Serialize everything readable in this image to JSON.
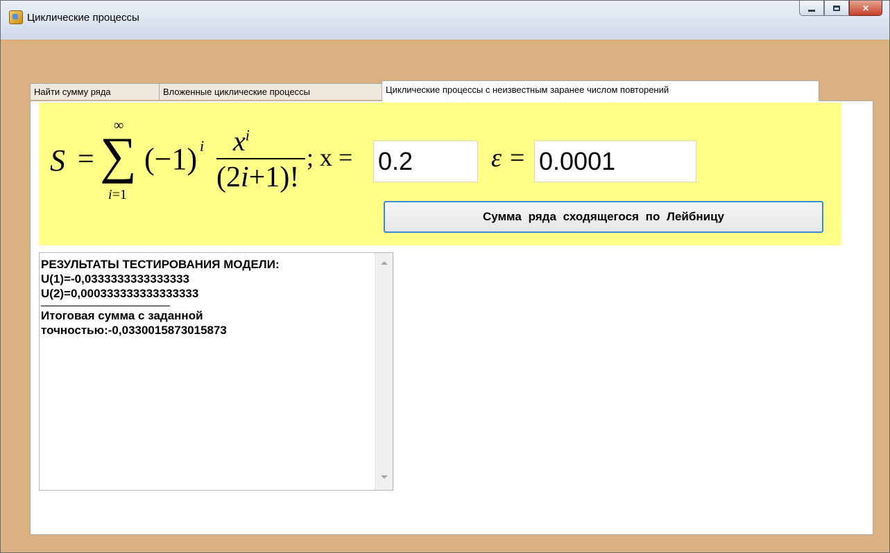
{
  "window": {
    "title": "Циклические процессы",
    "icons": {
      "app": "app-icon",
      "minimize": "minimize-icon",
      "maximize": "maximize-icon",
      "close": "close-icon"
    }
  },
  "tabs": [
    {
      "label": "Найти сумму ряда",
      "active": false
    },
    {
      "label": "Вложенные циклические процессы",
      "active": false
    },
    {
      "label": "Циклические процессы с неизвестным заранее числом повторений",
      "active": true
    }
  ],
  "formula": {
    "S": "S",
    "eq": "=",
    "sigma": "∑",
    "upper": "∞",
    "lower_i": "i",
    "lower_rest": "=1",
    "paren": "(−1)",
    "exp_i": "i",
    "num_x": "x",
    "num_exp": "i",
    "den_a": "(2",
    "den_i": "i",
    "den_b": "+1)!",
    "semi": "; x =",
    "eps": "ε ="
  },
  "inputs": {
    "x_value": "0.2",
    "eps_value": "0.0001"
  },
  "buttons": {
    "sum_label": "Сумма ряда сходящегося по Лейбницу"
  },
  "results": {
    "heading": "РЕЗУЛЬТАТЫ ТЕСТИРОВАНИЯ МОДЕЛИ:",
    "line1": "U(1)=-0,0333333333333333",
    "line2": "U(2)=0,000333333333333333",
    "total_label": "Итоговая сумма с заданной",
    "total_value": "точностью:-0,0330015873015873"
  },
  "colors": {
    "window_bg": "#dcb182",
    "formula_bg": "#ffff88",
    "button_border": "#3b89d3"
  }
}
